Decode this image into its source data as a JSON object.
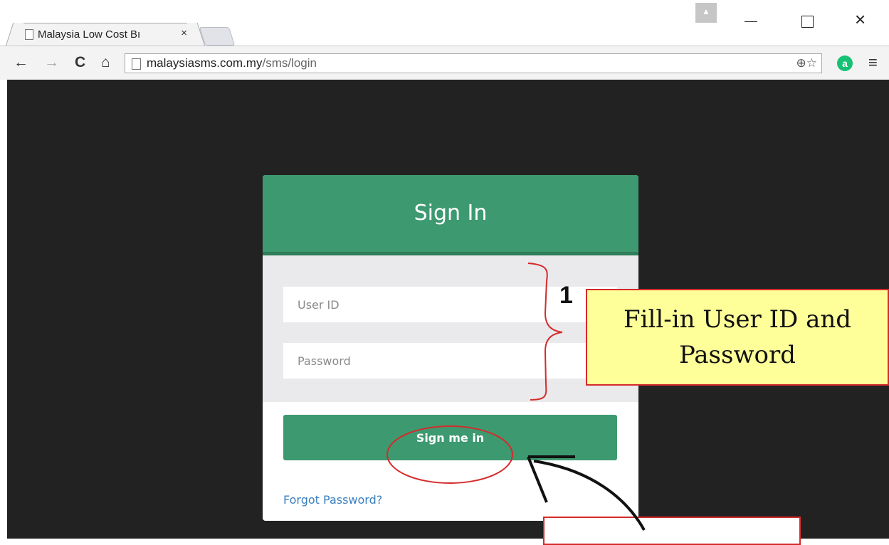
{
  "browser": {
    "tab_title": "Malaysia Low Cost Bı",
    "tab_close": "×",
    "url_host": "malaysiasms.com.my",
    "url_path": "/sms/login",
    "ext_icon_label": "a",
    "menu_glyph": "≡",
    "close_glyph": "×",
    "nav_back": "←",
    "nav_forward": "→",
    "nav_reload": "C",
    "nav_home": "⌂",
    "url_zoom_star": "⊕☆"
  },
  "login": {
    "title": "Sign In",
    "user_placeholder": "User ID",
    "password_placeholder": "Password",
    "submit_label": "Sign me in",
    "forgot_link": "Forgot Password?"
  },
  "annotation": {
    "step_number": "1",
    "callout_line1": "Fill-in User ID and",
    "callout_line2": "Password"
  },
  "colors": {
    "accent": "#3d9970",
    "page_bg": "#222222",
    "callout_bg": "#ffff99",
    "annotation_red": "#d42b2b"
  }
}
